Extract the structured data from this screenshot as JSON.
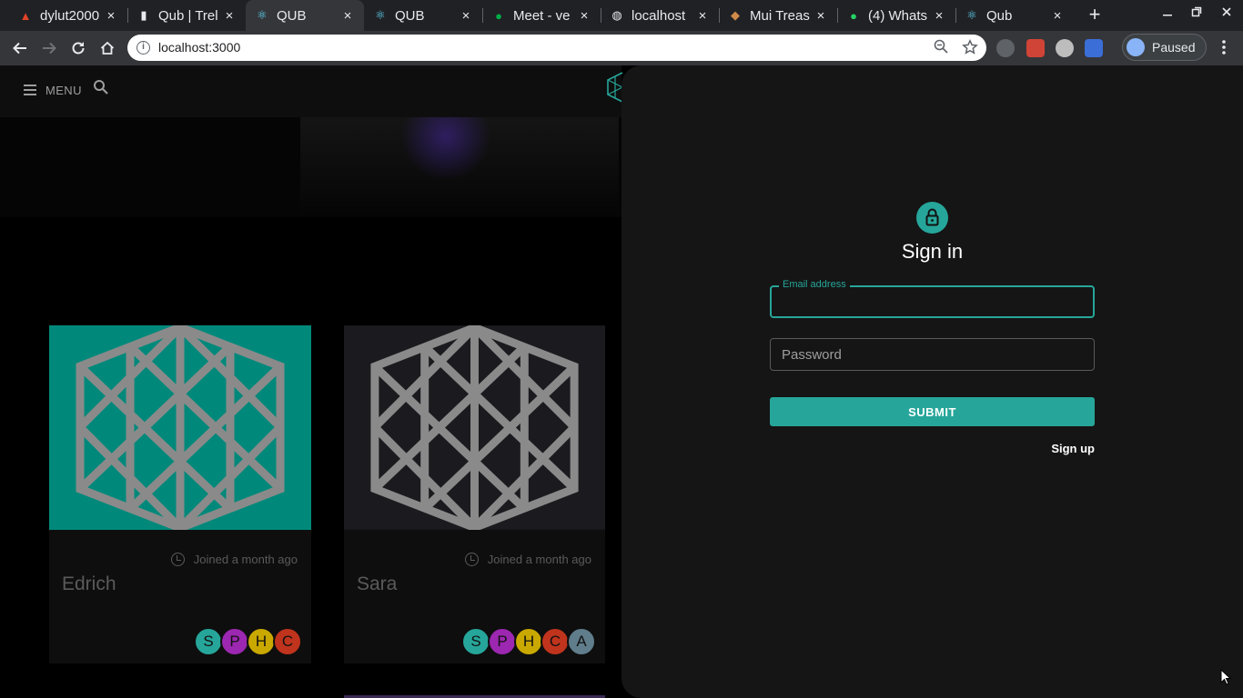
{
  "browser": {
    "tabs": [
      {
        "title": "dylut2000",
        "icon": "gitlab-icon",
        "active": false
      },
      {
        "title": "Qub | Trel",
        "icon": "trello-icon",
        "active": false
      },
      {
        "title": "QUB",
        "icon": "react-icon",
        "active": true
      },
      {
        "title": "QUB",
        "icon": "react-icon",
        "active": false
      },
      {
        "title": "Meet - ve",
        "icon": "meet-icon",
        "active": false
      },
      {
        "title": "localhost",
        "icon": "globe-icon",
        "active": false
      },
      {
        "title": "Mui Treas",
        "icon": "mui-icon",
        "active": false
      },
      {
        "title": "(4) Whats",
        "icon": "whatsapp-icon",
        "active": false
      },
      {
        "title": "Qub",
        "icon": "react-icon",
        "active": false
      }
    ],
    "close_glyph": "×",
    "new_tab_glyph": "+",
    "url": "localhost:3000",
    "profile_label": "Paused",
    "colors": {
      "frame": "#202124",
      "toolbar": "#35363a"
    }
  },
  "app": {
    "menu_label": "MENU",
    "accent_color": "#26a69a",
    "cards": [
      {
        "name": "Edrich",
        "joined": "Joined a month ago",
        "media_color": "#00897b",
        "avatars": [
          {
            "letter": "S",
            "color": "#26a69a"
          },
          {
            "letter": "P",
            "color": "#9c27b0"
          },
          {
            "letter": "H",
            "color": "#c9a800"
          },
          {
            "letter": "C",
            "color": "#c0341d"
          }
        ]
      },
      {
        "name": "Sara",
        "joined": "Joined a month ago",
        "media_color": "#1b1b1f",
        "avatars": [
          {
            "letter": "S",
            "color": "#26a69a"
          },
          {
            "letter": "P",
            "color": "#9c27b0"
          },
          {
            "letter": "H",
            "color": "#c9a800"
          },
          {
            "letter": "C",
            "color": "#c0341d"
          },
          {
            "letter": "A",
            "color": "#607d8b"
          }
        ]
      }
    ]
  },
  "signin": {
    "title": "Sign in",
    "email_label": "Email address",
    "email_value": "",
    "password_placeholder": "Password",
    "submit_label": "SUBMIT",
    "signup_link": "Sign up"
  }
}
